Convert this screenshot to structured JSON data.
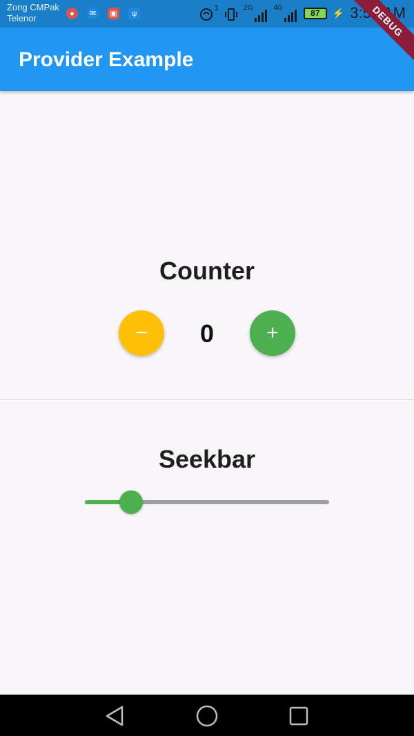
{
  "status_bar": {
    "carrier_line1": "Zong CMPak",
    "carrier_line2": "Telenor",
    "notification_icons": [
      "screen-record-icon",
      "messenger-icon",
      "gallery-icon",
      "usb-icon"
    ],
    "sim1_indicator": "1",
    "network_2g": "2G",
    "network_4g": "4G",
    "battery_level": "87",
    "time": "3:56 AM"
  },
  "debug_banner": "DEBUG",
  "app_bar": {
    "title": "Provider Example",
    "color": "#2196f3"
  },
  "counter": {
    "title": "Counter",
    "value": "0",
    "decrement_symbol": "−",
    "increment_symbol": "+",
    "decrement_color": "#ffc107",
    "increment_color": "#4caf50"
  },
  "seekbar": {
    "title": "Seekbar",
    "value_fraction": 0.19,
    "active_color": "#4caf50",
    "inactive_color": "#9e9ea0"
  },
  "nav_bar": {
    "buttons": [
      "back-icon",
      "home-icon",
      "recents-icon"
    ]
  }
}
